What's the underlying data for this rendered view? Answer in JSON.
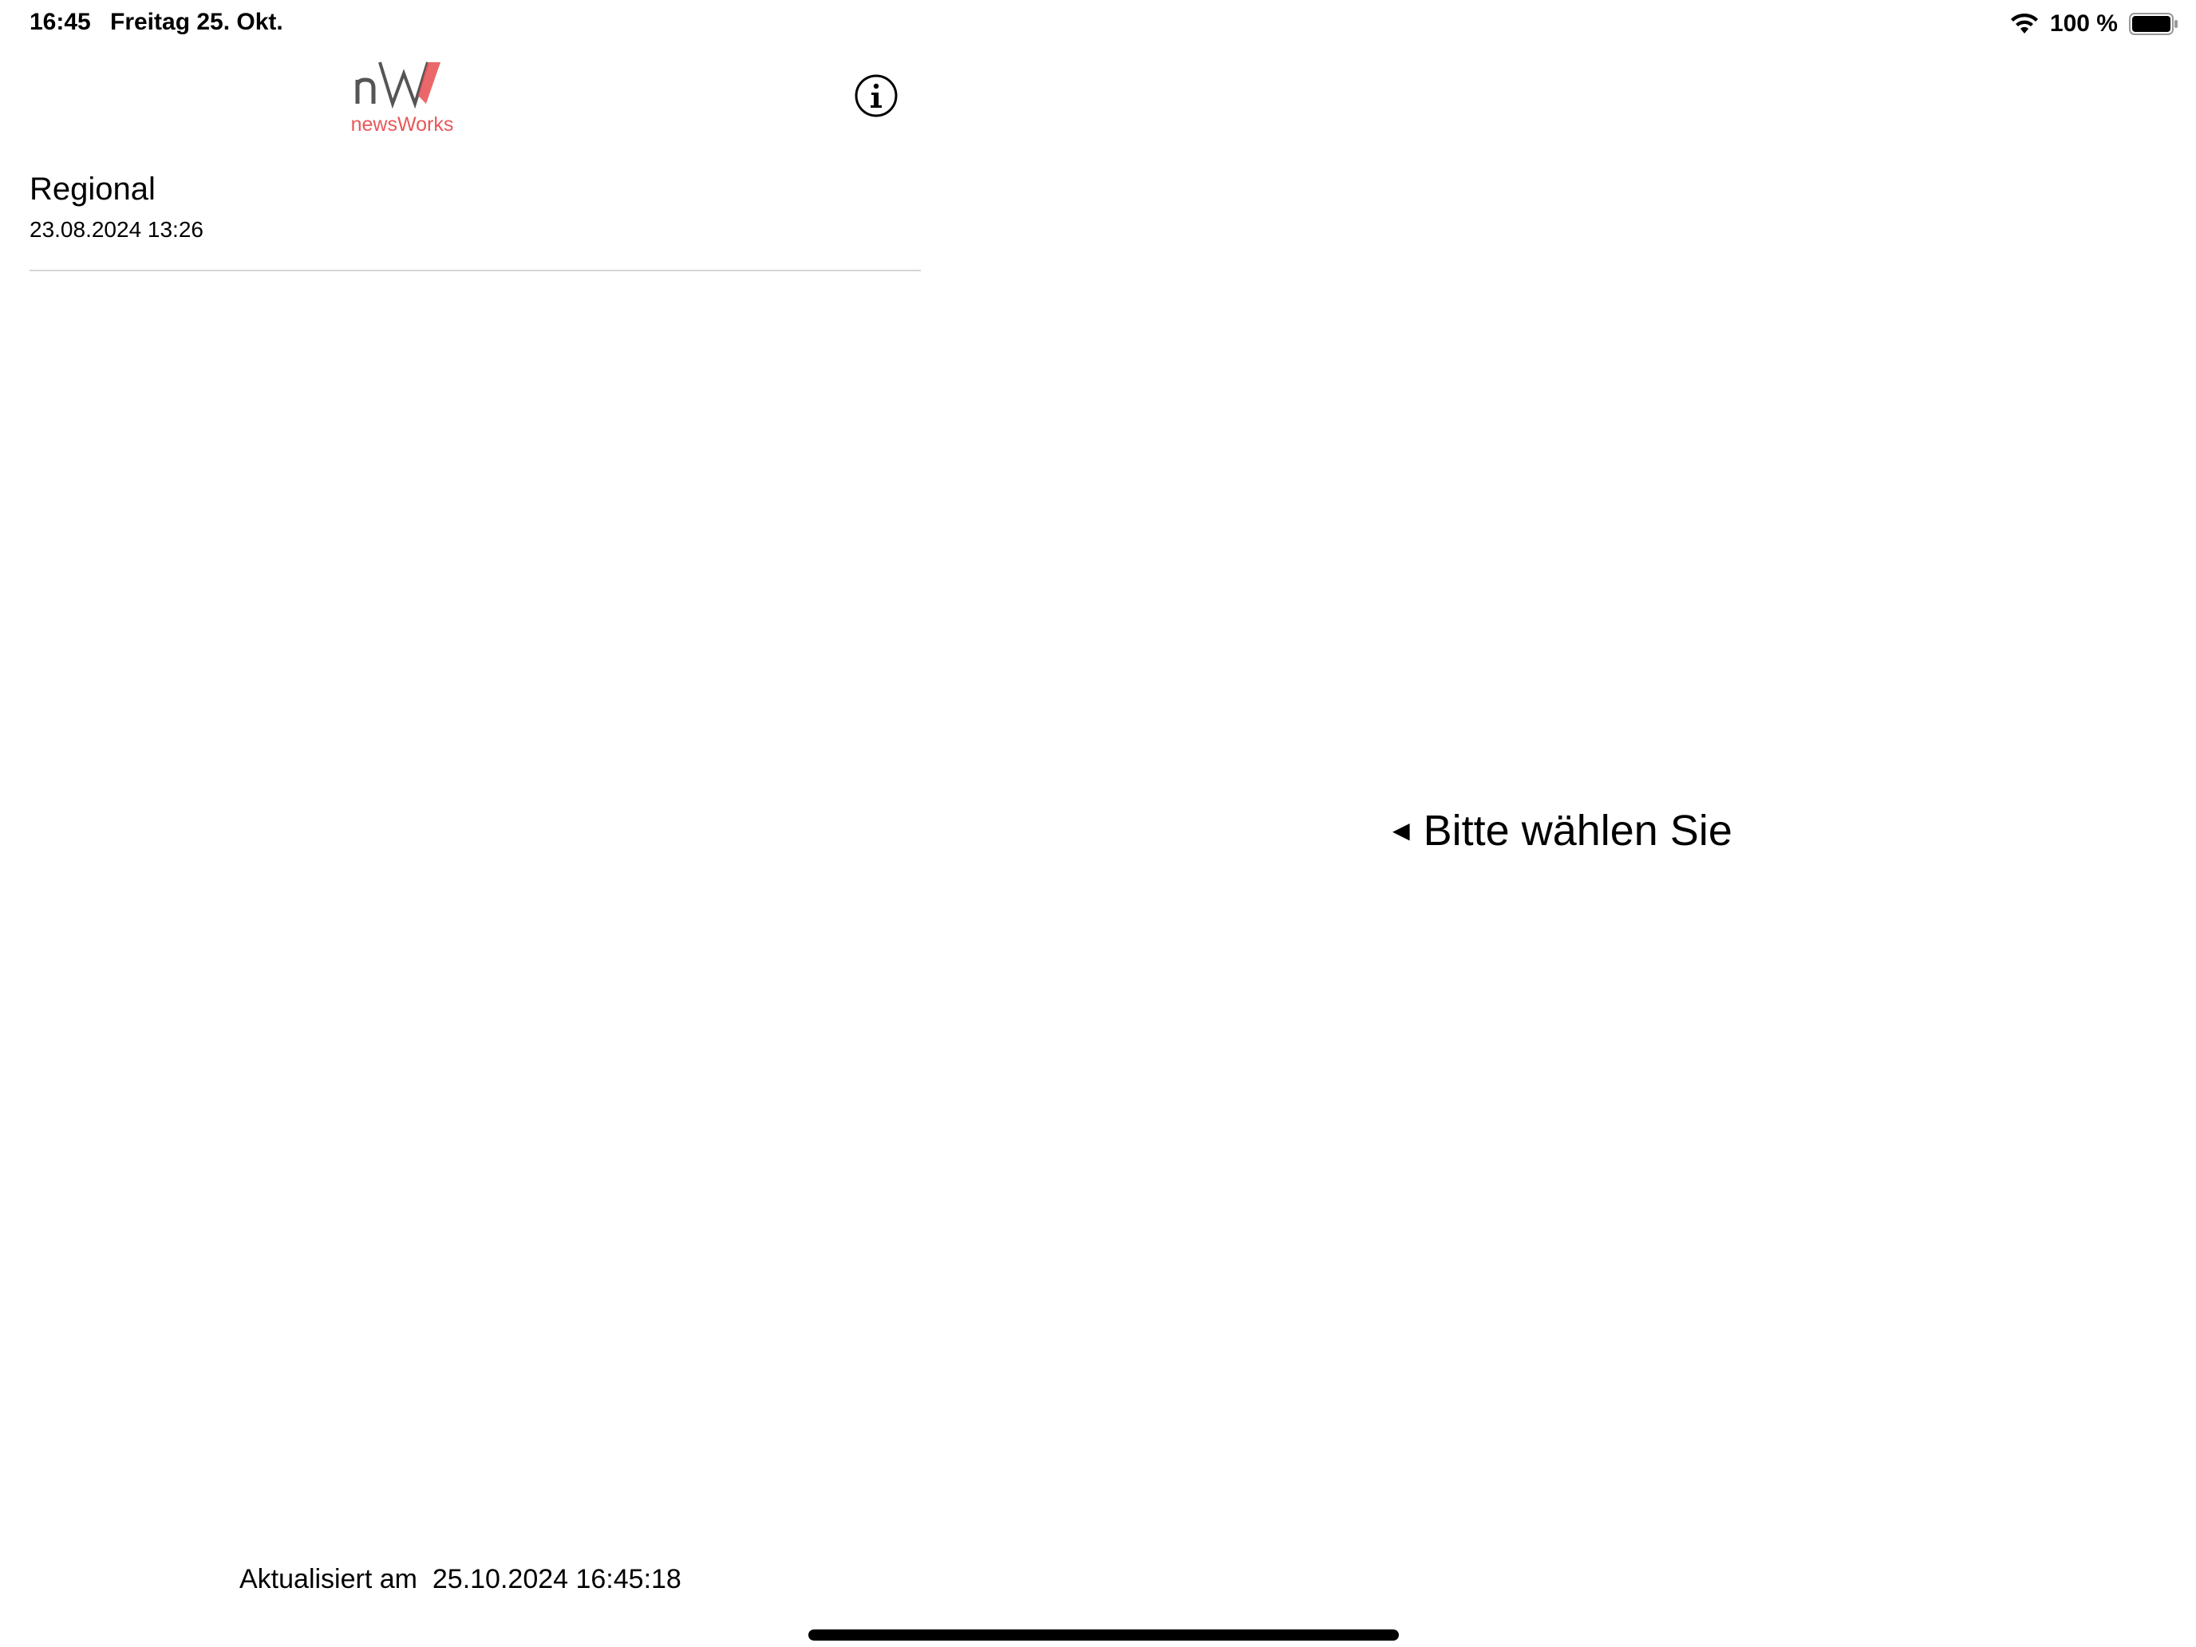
{
  "status_bar": {
    "time": "16:45",
    "date": "Freitag 25. Okt.",
    "battery_text": "100 %",
    "icons": [
      "wifi-icon",
      "battery-icon"
    ]
  },
  "sidebar": {
    "logo": {
      "mark": "nW",
      "subtitle": "newsWorks",
      "accent_color": "#e8585a",
      "mark_color": "#555555"
    },
    "info_icon": "info-icon",
    "items": [
      {
        "title": "Regional",
        "date": "23.08.2024 13:26"
      }
    ],
    "footer": {
      "label": "Aktualisiert am",
      "value": "25.10.2024 16:45:18"
    }
  },
  "detail": {
    "placeholder_arrow": "◄",
    "placeholder_text": "Bitte wählen Sie"
  }
}
